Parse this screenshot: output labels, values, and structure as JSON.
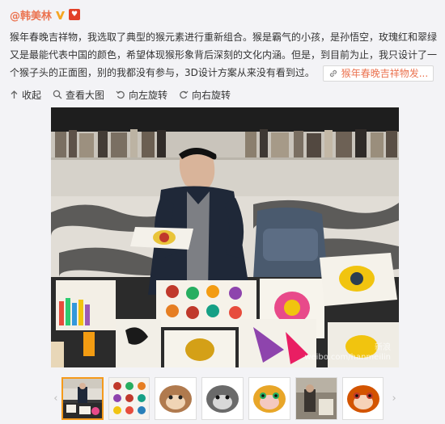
{
  "post": {
    "author": "@韩美林",
    "text": "猴年春晚吉祥物，我选取了典型的猴元素进行重新组合。猴是霸气的小孩，是孙悟空，玫瑰红和翠绿又是最能代表中国的颜色，希望体现猴形象背后深刻的文化内涵。但是，到目前为止，我只设计了一个猴子头的正面图，别的我都没有参与，3D设计方案从来没有看到过。",
    "link_label": "猴年春晚吉祥物发..."
  },
  "toolbar": {
    "collapse": "收起",
    "view_large": "查看大图",
    "rotate_left": "向左旋转",
    "rotate_right": "向右旋转"
  },
  "photo": {
    "watermark_line1": "新浪",
    "watermark_line2": "weibo.com/hanmeilin"
  },
  "thumbnails": [
    {
      "name": "thumb-artist-photo"
    },
    {
      "name": "thumb-sketch-sheet"
    },
    {
      "name": "thumb-monkey-brown"
    },
    {
      "name": "thumb-monkey-gray"
    },
    {
      "name": "thumb-monkey-color"
    },
    {
      "name": "thumb-workshop"
    },
    {
      "name": "thumb-monkey-red"
    }
  ],
  "colors": {
    "accent": "#eb7350",
    "thumb_active": "#f59a1b"
  }
}
